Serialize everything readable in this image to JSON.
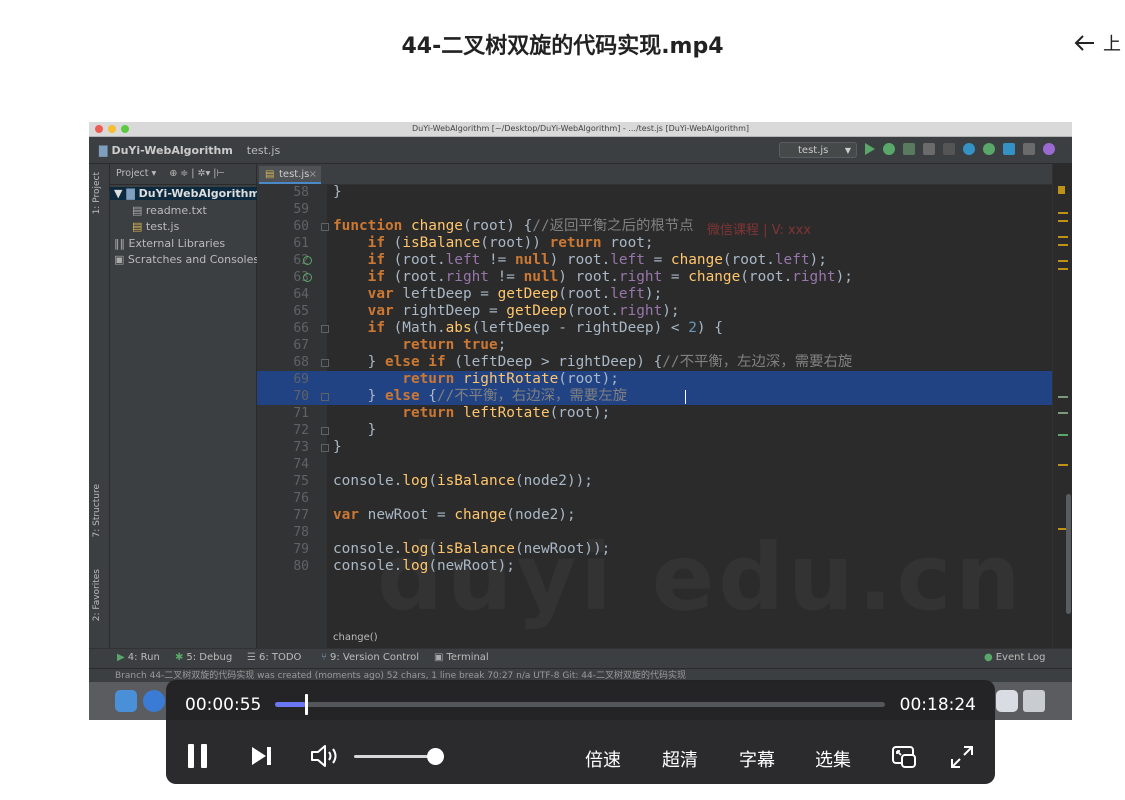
{
  "page": {
    "title": "44-二叉树双旋的代码实现.mp4",
    "back_label": "上"
  },
  "window": {
    "title": "DuYi-WebAlgorithm [~/Desktop/DuYi-WebAlgorithm] - .../test.js [DuYi-WebAlgorithm]"
  },
  "toolbar": {
    "project_crumb": "DuYi-WebAlgorithm",
    "file_crumb": "test.js",
    "run_config": "test.js"
  },
  "sidebar": {
    "strip_labels": [
      "1: Project",
      "7: Structure",
      "2: Favorites"
    ],
    "header": "Project ▾",
    "items": [
      {
        "label": "DuYi-WebAlgorithm",
        "kind": "root"
      },
      {
        "label": "readme.txt",
        "kind": "file"
      },
      {
        "label": "test.js",
        "kind": "file"
      },
      {
        "label": "External Libraries",
        "kind": "lib"
      },
      {
        "label": "Scratches and Consoles",
        "kind": "scratch"
      }
    ]
  },
  "editor": {
    "tab": "test.js",
    "watermark_top": "微信课程 | V: xxx",
    "watermark": "duyi edu.cn",
    "breadcrumb_hint": "change()",
    "lines": [
      {
        "n": "58",
        "html": "}"
      },
      {
        "n": "59",
        "html": ""
      },
      {
        "n": "60",
        "html": "<span class=\"kw\">function</span> <span class=\"fn\">change</span>(root) {<span class=\"cmt\">//返回平衡之后的根节点</span>"
      },
      {
        "n": "61",
        "html": "    <span class=\"kw\">if</span> (<span class=\"fn\">isBalance</span>(root)) <span class=\"kw\">return</span> root;"
      },
      {
        "n": "62",
        "html": "    <span class=\"kw\">if</span> (root.<span class=\"prop\">left</span> != <span class=\"kw\">null</span>) root.<span class=\"prop\">left</span> = <span class=\"fn\">change</span>(root.<span class=\"prop\">left</span>);"
      },
      {
        "n": "63",
        "html": "    <span class=\"kw\">if</span> (root.<span class=\"prop\">right</span> != <span class=\"kw\">null</span>) root.<span class=\"prop\">right</span> = <span class=\"fn\">change</span>(root.<span class=\"prop\">right</span>);"
      },
      {
        "n": "64",
        "html": "    <span class=\"kw\">var</span> leftDeep = <span class=\"fn\">getDeep</span>(root.<span class=\"prop\">left</span>);"
      },
      {
        "n": "65",
        "html": "    <span class=\"kw\">var</span> rightDeep = <span class=\"fn\">getDeep</span>(root.<span class=\"prop\">right</span>);"
      },
      {
        "n": "66",
        "html": "    <span class=\"kw\">if</span> (Math.<span class=\"fn\">abs</span>(leftDeep - rightDeep) &lt; <span class=\"num\">2</span>) {"
      },
      {
        "n": "67",
        "html": "        <span class=\"kw\">return true</span>;"
      },
      {
        "n": "68",
        "html": "    } <span class=\"kw\">else if</span> (leftDeep &gt; rightDeep) {<span class=\"cmt\">//不平衡，左边深，需要右旋</span>"
      },
      {
        "n": "69",
        "html": "        <span class=\"kw\">return</span> <span class=\"fn\">rightRotate</span>(root);"
      },
      {
        "n": "70",
        "html": "    } <span class=\"kw\">else</span> {<span class=\"cmt\">//不平衡，右边深，需要左旋</span>"
      },
      {
        "n": "71",
        "html": "        <span class=\"kw\">return</span> <span class=\"fn\">leftRotate</span>(root);"
      },
      {
        "n": "72",
        "html": "    }"
      },
      {
        "n": "73",
        "html": "}"
      },
      {
        "n": "74",
        "html": ""
      },
      {
        "n": "75",
        "html": "console.<span class=\"fn\">log</span>(<span class=\"fn\">isBalance</span>(node2));"
      },
      {
        "n": "76",
        "html": ""
      },
      {
        "n": "77",
        "html": "<span class=\"kw\">var</span> newRoot = <span class=\"fn\">change</span>(node2);"
      },
      {
        "n": "78",
        "html": ""
      },
      {
        "n": "79",
        "html": "console.<span class=\"fn\">log</span>(<span class=\"fn\">isBalance</span>(newRoot));"
      },
      {
        "n": "80",
        "html": "console.<span class=\"fn\">log</span>(newRoot);"
      }
    ],
    "highlighted_lines": [
      "69",
      "70"
    ]
  },
  "tool_windows": [
    {
      "label": "4: Run",
      "icon": "run-icon"
    },
    {
      "label": "5: Debug",
      "icon": "debug-icon"
    },
    {
      "label": "6: TODO",
      "icon": "todo-icon"
    },
    {
      "label": "9: Version Control",
      "icon": "vcs-icon"
    },
    {
      "label": "Terminal",
      "icon": "terminal-icon"
    }
  ],
  "event_log": "Event Log",
  "status": "Branch 44-二叉树双旋的代码实现 was created (moments ago)   52 chars, 1 line break   70:27   n/a   UTF-8   Git: 44-二叉树双旋的代码实现",
  "player": {
    "current_time": "00:00:55",
    "duration": "00:18:24",
    "progress": 0.05,
    "volume": 0.9,
    "speed_label": "倍速",
    "quality_label": "超清",
    "subtitle_label": "字幕",
    "episodes_label": "选集"
  },
  "colors": {
    "progress": "#6a77f5",
    "keyword": "#cc7832",
    "function": "#ffc66d",
    "property": "#9876aa",
    "selection": "#214283"
  }
}
